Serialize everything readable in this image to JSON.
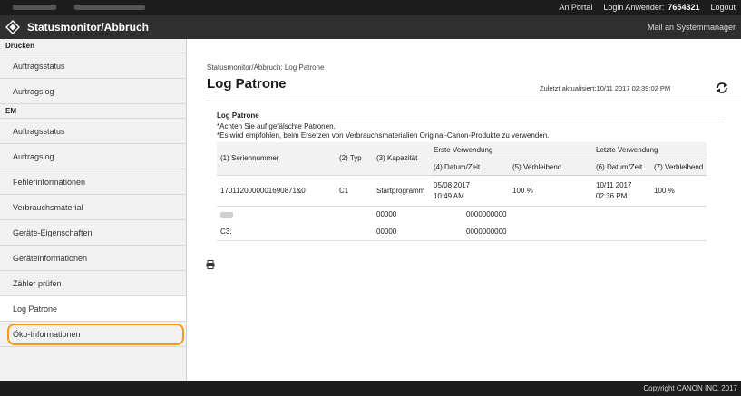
{
  "topbar": {
    "links": [
      "An Portal",
      "Login Anwender:",
      "7654321",
      "Logout"
    ]
  },
  "header": {
    "title": "Statusmonitor/Abbruch",
    "mail_link": "Mail an Systemmanager"
  },
  "sidebar": {
    "sections": [
      {
        "heading": "Drucken",
        "items": [
          "Auftragsstatus",
          "Auftragslog"
        ]
      },
      {
        "heading": "EM",
        "items": [
          "Auftragsstatus",
          "Auftragslog",
          "Fehlerinformationen",
          "Verbrauchsmaterial",
          "Geräte-Eigenschaften",
          "Geräteinformationen",
          "Zähler prüfen",
          "Log Patrone",
          "Öko-Informationen"
        ]
      }
    ],
    "selected": "Log Patrone"
  },
  "main": {
    "breadcrumb": "Statusmonitor/Abbruch: Log Patrone",
    "title": "Log Patrone",
    "last_updated": "Zuletzt aktualisiert:10/11 2017 02:39:02 PM",
    "section_title": "Log Patrone",
    "note1": "*Achten Sie auf gefälschte Patronen.",
    "note2": "*Es wird empfohlen, beim Ersetzen von Verbrauchsmaterialien Original-Canon-Produkte zu verwenden.",
    "table": {
      "col_serial": "(1) Seriennummer",
      "col_type": "(2) Typ",
      "col_capacity": "(3) Kapazität",
      "group_first": "Erste Verwendung",
      "group_last": "Letzte Verwendung",
      "col_first_date": "(4) Datum/Zeit",
      "col_first_remaining": "(5) Verbleibend",
      "col_last_date": "(6) Datum/Zeit",
      "col_last_remaining": "(7) Verbleibend",
      "rows": [
        {
          "serial": "1701120000001690871&0",
          "type": "C1",
          "capacity": "Startprogramm",
          "first_date": "05/08 2017",
          "first_time": "10:49 AM",
          "first_remaining": "100 %",
          "last_date": "10/11 2017",
          "last_time": "02:36 PM",
          "last_remaining": "100 %"
        },
        {
          "serial": "",
          "type": "",
          "capacity": "00000",
          "first_date": "0000000000",
          "first_time": "",
          "first_remaining": "",
          "last_date": "",
          "last_time": "",
          "last_remaining": ""
        },
        {
          "serial": "C3:",
          "type": "",
          "capacity": "00000",
          "first_date": "0000000000",
          "first_time": "",
          "first_remaining": "",
          "last_date": "",
          "last_time": "",
          "last_remaining": ""
        }
      ]
    }
  },
  "footer": {
    "copyright": "Copyright CANON INC. 2017"
  },
  "colors": {
    "topbar": "#1c1c1c",
    "titlebar": "#2f2f2f",
    "sidebar": "#f1f1f1",
    "highlight": "#f39c12"
  },
  "icons": {
    "logo": "canon-device-logo-icon",
    "refresh": "refresh-icon",
    "print": "print-icon"
  }
}
